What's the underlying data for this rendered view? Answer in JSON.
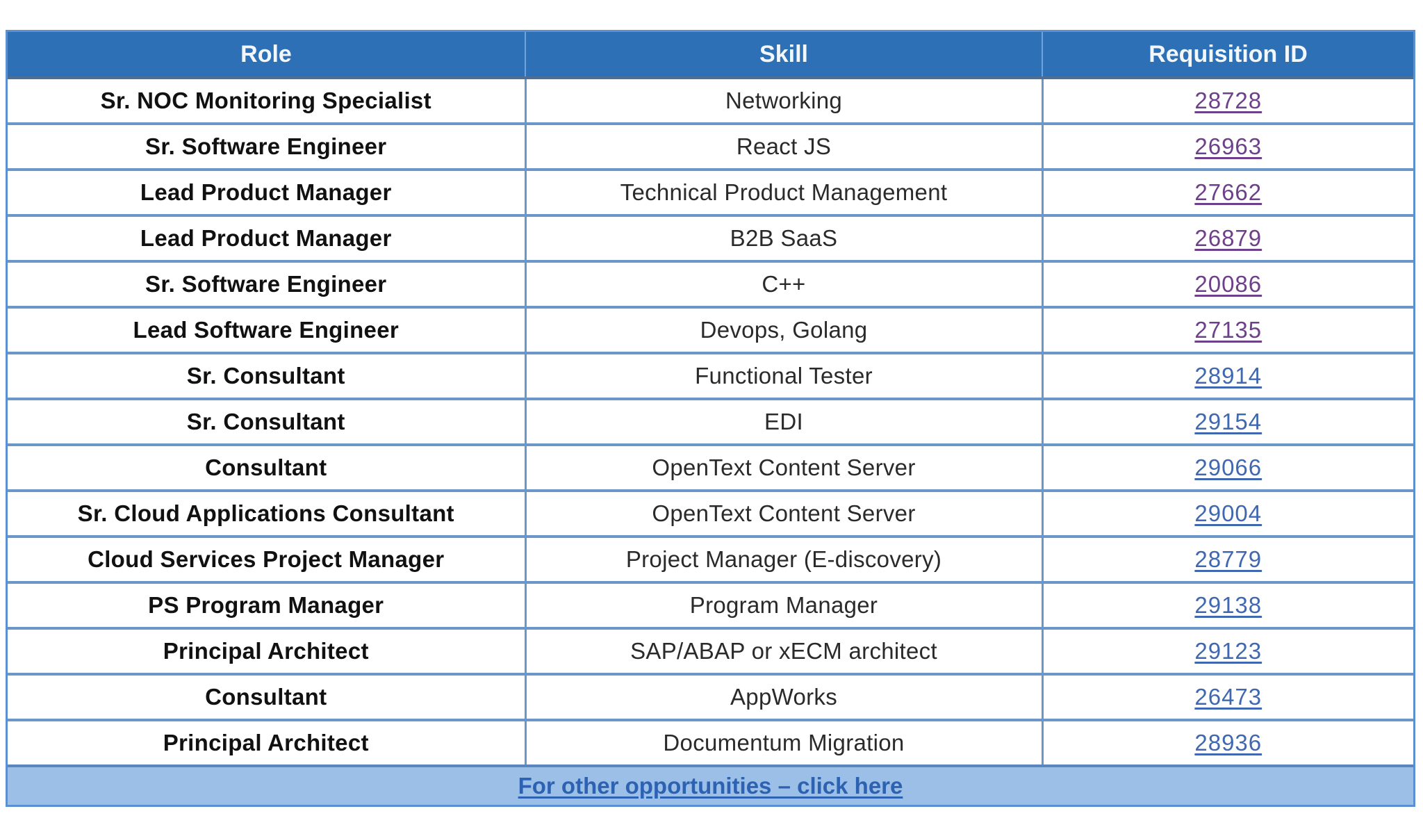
{
  "table": {
    "headers": {
      "role": "Role",
      "skill": "Skill",
      "requisition_id": "Requisition ID"
    },
    "rows": [
      {
        "role": "Sr. NOC Monitoring Specialist",
        "skill": "Networking",
        "requisition_id": "28728",
        "visited": true
      },
      {
        "role": "Sr. Software Engineer",
        "skill": "React JS",
        "requisition_id": "26963",
        "visited": true
      },
      {
        "role": "Lead Product Manager",
        "skill": "Technical Product Management",
        "requisition_id": "27662",
        "visited": true
      },
      {
        "role": "Lead Product Manager",
        "skill": "B2B SaaS",
        "requisition_id": "26879",
        "visited": true
      },
      {
        "role": "Sr. Software Engineer",
        "skill": "C++",
        "requisition_id": "20086",
        "visited": true
      },
      {
        "role": "Lead Software Engineer",
        "skill": "Devops, Golang",
        "requisition_id": "27135",
        "visited": true
      },
      {
        "role": "Sr. Consultant",
        "skill": "Functional Tester",
        "requisition_id": "28914",
        "visited": false
      },
      {
        "role": "Sr. Consultant",
        "skill": "EDI",
        "requisition_id": "29154",
        "visited": false
      },
      {
        "role": "Consultant",
        "skill": "OpenText Content Server",
        "requisition_id": "29066",
        "visited": false
      },
      {
        "role": "Sr. Cloud Applications Consultant",
        "skill": "OpenText Content Server",
        "requisition_id": "29004",
        "visited": false
      },
      {
        "role": "Cloud Services Project Manager",
        "skill": "Project Manager (E-discovery)",
        "requisition_id": "28779",
        "visited": false
      },
      {
        "role": "PS Program Manager",
        "skill": "Program Manager",
        "requisition_id": "29138",
        "visited": false
      },
      {
        "role": "Principal Architect",
        "skill": "SAP/ABAP or xECM architect",
        "requisition_id": "29123",
        "visited": false
      },
      {
        "role": "Consultant",
        "skill": "AppWorks",
        "requisition_id": "26473",
        "visited": false
      },
      {
        "role": "Principal Architect",
        "skill": "Documentum Migration",
        "requisition_id": "28936",
        "visited": false
      }
    ],
    "footer_link": "For other opportunities – click here"
  },
  "colors": {
    "header_bg": "#2e70b5",
    "border": "#6a97c8",
    "footer_bg": "#9bbfe6",
    "link_visited": "#6e3f8a",
    "link_unvisited": "#3f68b0"
  }
}
